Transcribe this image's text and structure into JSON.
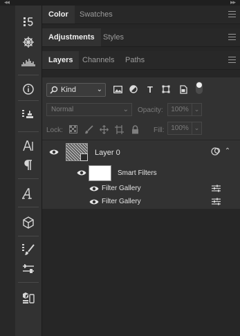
{
  "panels": {
    "group1_tabs": [
      {
        "label": "Color",
        "active": true
      },
      {
        "label": "Swatches",
        "active": false
      }
    ],
    "group2_tabs": [
      {
        "label": "Adjustments",
        "active": true
      },
      {
        "label": "Styles",
        "active": false
      }
    ],
    "group3_tabs": [
      {
        "label": "Layers",
        "active": true
      },
      {
        "label": "Channels",
        "active": false
      },
      {
        "label": "Paths",
        "active": false
      }
    ]
  },
  "layers": {
    "filter_kind": "Kind",
    "blend_mode": "Normal",
    "opacity_label": "Opacity:",
    "opacity_value": "100%",
    "lock_label": "Lock:",
    "fill_label": "Fill:",
    "fill_value": "100%",
    "items": [
      {
        "name": "Layer 0",
        "visible": true
      },
      {
        "name": "Smart Filters",
        "visible": true
      },
      {
        "name": "Filter Gallery",
        "visible": true
      },
      {
        "name": "Filter Gallery",
        "visible": true
      }
    ]
  },
  "toolbar_icons": [
    "history-brush-icon",
    "navigator-icon",
    "histogram-icon",
    "info-icon",
    "layer-comps-icon",
    "character-icon",
    "paragraph-icon",
    "glyphs-icon",
    "3d-icon",
    "brush-settings-icon",
    "properties-icon",
    "device-preview-icon"
  ],
  "colors": {
    "panel": "#323232",
    "background": "#262626",
    "tab_active": "#323232",
    "text": "#e4e4e4"
  }
}
